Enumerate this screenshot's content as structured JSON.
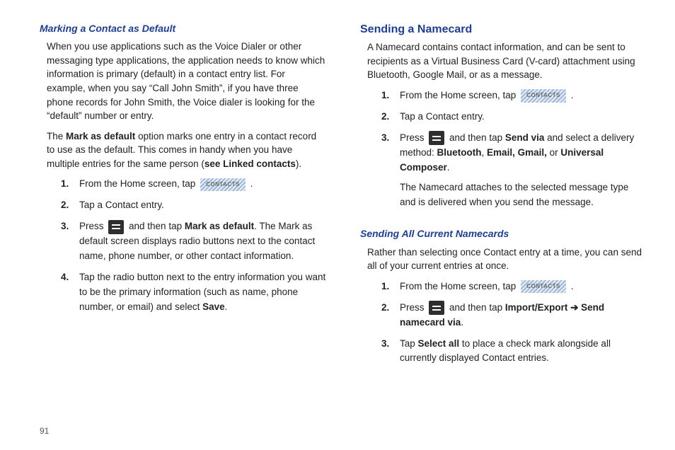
{
  "page_number": "91",
  "contacts_label": "CONTACTS",
  "left": {
    "h1": "Marking a Contact as Default",
    "p1": "When you use applications such as the Voice Dialer or other messaging type applications, the application needs to know which information is primary (default) in a contact entry list. For example, when you say “Call John Smith”, if you have three phone records for John Smith, the Voice dialer is looking for the “default” number or entry.",
    "p2a": "The ",
    "p2b": "Mark as default",
    "p2c": " option marks one entry in a contact record to use as the default. This comes in handy when you have multiple entries for the same person (",
    "p2d": "see Linked contacts",
    "p2e": ").",
    "s1a": "From the Home screen, tap ",
    "s1b": " .",
    "s2": "Tap a Contact entry.",
    "s3a": "Press ",
    "s3b": " and then tap ",
    "s3c": "Mark as default",
    "s3d": ". The Mark as default screen displays radio buttons next to the contact name, phone number, or other contact information.",
    "s4a": "Tap the radio button next to the entry information you want to be the primary information (such as name, phone number, or email) and select ",
    "s4b": "Save",
    "s4c": "."
  },
  "right": {
    "h1": "Sending a Namecard",
    "p1": "A Namecard contains contact information, and can be sent to recipients as a Virtual Business Card (V-card) attachment using Bluetooth, Google Mail, or as a message.",
    "s1a": "From the Home screen, tap ",
    "s1b": " .",
    "s2": "Tap a Contact entry.",
    "s3a": "Press ",
    "s3b": " and then tap ",
    "s3c": "Send via",
    "s3d": " and select a delivery method: ",
    "s3e": "Bluetooth",
    "s3f": ", ",
    "s3g": "Email, Gmail,",
    "s3h": " or ",
    "s3i": "Universal Composer",
    "s3j": ".",
    "s3k": "The Namecard attaches to the selected message type and is delivered when you send the message.",
    "h2": "Sending All Current Namecards",
    "p2": "Rather than selecting once Contact entry at a time, you can send all of your current entries at once.",
    "t1a": "From the Home screen, tap ",
    "t1b": " .",
    "t2a": "Press ",
    "t2b": " and then tap ",
    "t2c": "Import/Export ➔ Send namecard via",
    "t2d": ".",
    "t3a": "Tap ",
    "t3b": "Select all",
    "t3c": " to place a check mark alongside all currently displayed Contact entries."
  }
}
